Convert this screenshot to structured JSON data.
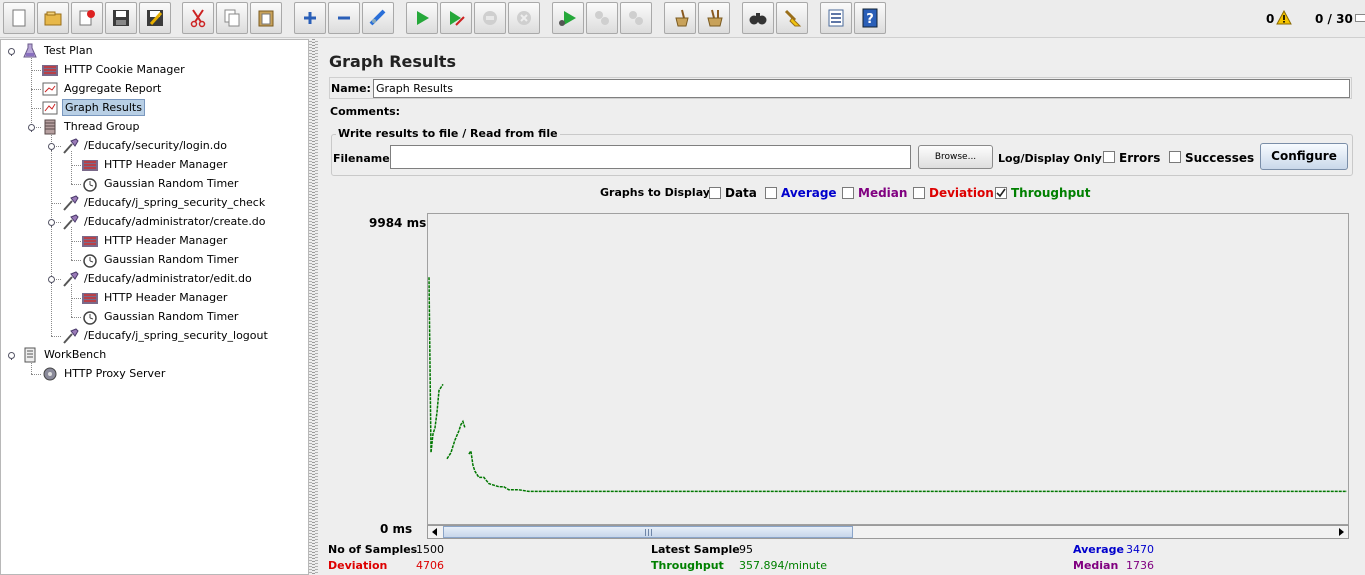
{
  "toolbar": {
    "buttons": [
      "new-icon",
      "open-icon",
      "close-icon",
      "save-icon",
      "save-as-icon",
      "cut-icon",
      "copy-icon",
      "paste-icon",
      "expand-icon",
      "collapse-icon",
      "toggle-icon",
      "start-icon",
      "start-no-pauses-icon",
      "stop-icon",
      "shutdown-icon",
      "remote-start-icon",
      "remote-stop-icon",
      "remote-shutdown-icon",
      "clear-icon",
      "clear-all-icon",
      "search-icon",
      "reset-search-icon",
      "function-helper-icon",
      "help-icon"
    ],
    "error_count": "0",
    "thread_status": "0 / 30"
  },
  "tree": {
    "nodes": [
      {
        "label": "Test Plan",
        "icon": "test-plan-icon",
        "level": 0
      },
      {
        "label": "HTTP Cookie Manager",
        "icon": "cookie-manager-icon",
        "level": 1
      },
      {
        "label": "Aggregate Report",
        "icon": "report-icon",
        "level": 1
      },
      {
        "label": "Graph Results",
        "icon": "graph-icon",
        "level": 1,
        "selected": true
      },
      {
        "label": "Thread Group",
        "icon": "thread-group-icon",
        "level": 1
      },
      {
        "label": "/Educafy/security/login.do",
        "icon": "sampler-icon",
        "level": 2
      },
      {
        "label": "HTTP Header Manager",
        "icon": "header-manager-icon",
        "level": 3
      },
      {
        "label": "Gaussian Random Timer",
        "icon": "timer-icon",
        "level": 3
      },
      {
        "label": "/Educafy/j_spring_security_check",
        "icon": "sampler-icon",
        "level": 2
      },
      {
        "label": "/Educafy/administrator/create.do",
        "icon": "sampler-icon",
        "level": 2
      },
      {
        "label": "HTTP Header Manager",
        "icon": "header-manager-icon",
        "level": 3
      },
      {
        "label": "Gaussian Random Timer",
        "icon": "timer-icon",
        "level": 3
      },
      {
        "label": "/Educafy/administrator/edit.do",
        "icon": "sampler-icon",
        "level": 2
      },
      {
        "label": "HTTP Header Manager",
        "icon": "header-manager-icon",
        "level": 3
      },
      {
        "label": "Gaussian Random Timer",
        "icon": "timer-icon",
        "level": 3
      },
      {
        "label": "/Educafy/j_spring_security_logout",
        "icon": "sampler-icon",
        "level": 2
      },
      {
        "label": "WorkBench",
        "icon": "workbench-icon",
        "level": 0
      },
      {
        "label": "HTTP Proxy Server",
        "icon": "proxy-icon",
        "level": 1
      }
    ]
  },
  "panel": {
    "title": "Graph Results",
    "name_label": "Name:",
    "name_value": "Graph Results",
    "comments_label": "Comments:",
    "file_legend": "Write results to file / Read from file",
    "filename_label": "Filename",
    "filename_value": "",
    "browse_label": "Browse...",
    "log_display_label": "Log/Display Only:",
    "errors_label": "Errors",
    "successes_label": "Successes",
    "configure_label": "Configure"
  },
  "graphs_to_display": {
    "label": "Graphs to Display",
    "options": [
      {
        "label": "Data",
        "checked": false,
        "color": "#000000"
      },
      {
        "label": "Average",
        "checked": false,
        "color": "#0000cc"
      },
      {
        "label": "Median",
        "checked": false,
        "color": "#800080"
      },
      {
        "label": "Deviation",
        "checked": false,
        "color": "#dd0000"
      },
      {
        "label": "Throughput",
        "checked": true,
        "color": "#008000"
      }
    ]
  },
  "chart_data": {
    "type": "line",
    "y_max_label": "9984  ms",
    "y_min_label": "0  ms",
    "ylim": [
      0,
      9984
    ],
    "series": [
      {
        "color": "#007700",
        "x": [
          0,
          2,
          4,
          6,
          8,
          10,
          12,
          14,
          16,
          18,
          20,
          22,
          24,
          26,
          28,
          30,
          32,
          34,
          36,
          38,
          40,
          42,
          44,
          46,
          48,
          50,
          55,
          60,
          65,
          70,
          75,
          80,
          90,
          100,
          110,
          120,
          130,
          140,
          150,
          160,
          170,
          180,
          190,
          200,
          220,
          240,
          260,
          280,
          300,
          320,
          340,
          360,
          380,
          400,
          420,
          440,
          460,
          480,
          500,
          520,
          540,
          560,
          580,
          600,
          620,
          640,
          660,
          680,
          700,
          720,
          740,
          760,
          780,
          800,
          820,
          840,
          860,
          880,
          900,
          920
        ],
        "y": [
          7950,
          2300,
          2900,
          3100,
          3600,
          4300,
          4400,
          4500,
          null,
          2100,
          2200,
          2300,
          2500,
          2700,
          2850,
          3000,
          3200,
          3300,
          3100,
          null,
          2250,
          2350,
          1900,
          1700,
          1600,
          1500,
          1500,
          1300,
          1250,
          1200,
          1200,
          1100,
          1100,
          1050,
          1050,
          1050,
          1050,
          1050,
          1050,
          1050,
          1050,
          1050,
          1050,
          1050,
          1050,
          1050,
          1050,
          1050,
          1050,
          1050,
          1050,
          1050,
          1050,
          1050,
          1050,
          1050,
          1050,
          1050,
          1050,
          1050,
          1050,
          1050,
          1050,
          1050,
          1050,
          1050,
          1050,
          1050,
          1050,
          1050,
          1050,
          1050,
          1050,
          1050,
          1050,
          1050,
          1050,
          1050,
          1050,
          1050
        ]
      }
    ]
  },
  "stats": {
    "samples_label": "No of Samples",
    "samples_value": "1500",
    "deviation_label": "Deviation",
    "deviation_value": "4706",
    "latest_label": "Latest Sample",
    "latest_value": "95",
    "throughput_label": "Throughput",
    "throughput_value": "357.894/minute",
    "average_label": "Average",
    "average_value": "3470",
    "median_label": "Median",
    "median_value": "1736"
  }
}
